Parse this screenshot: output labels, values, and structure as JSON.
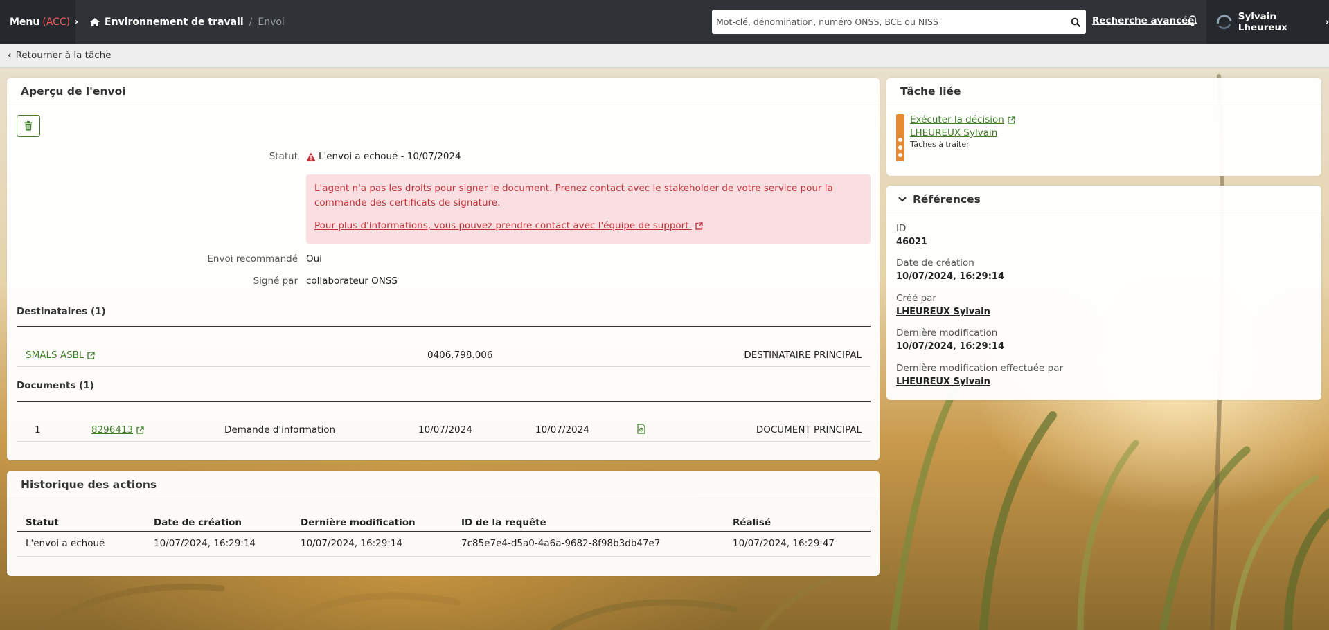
{
  "topbar": {
    "menu_label": "Menu",
    "menu_env": "(ACC)",
    "breadcrumb_1": "Environnement de travail",
    "breadcrumb_sep": "/",
    "breadcrumb_2": "Envoi",
    "search_placeholder": "Mot-clé, dénomination, numéro ONSS, BCE ou NISS",
    "advanced_search": "Recherche avancée",
    "user_name": "Sylvain Lheureux"
  },
  "subbar": {
    "back_label": "Retourner à la tâche"
  },
  "apercu": {
    "title": "Aperçu de l'envoi",
    "statut_label": "Statut",
    "statut_value": "L'envoi a echoué - 10/07/2024",
    "alert_text": "L'agent n'a pas les droits pour signer le document. Prenez contact avec le stakeholder de votre service pour la commande des certificats de signature.",
    "alert_link": "Pour plus d'informations, vous pouvez prendre contact avec l'équipe de support.",
    "recommande_label": "Envoi recommandé",
    "recommande_value": "Oui",
    "signe_label": "Signé par",
    "signe_value": "collaborateur ONSS",
    "destinataires_title": "Destinataires (1)",
    "destinataires": [
      {
        "name": "SMALS ASBL",
        "number": "0406.798.006",
        "role": "DESTINATAIRE PRINCIPAL"
      }
    ],
    "documents_title": "Documents (1)",
    "documents": [
      {
        "index": "1",
        "id": "8296413",
        "type": "Demande d'information",
        "date1": "10/07/2024",
        "date2": "10/07/2024",
        "role": "DOCUMENT PRINCIPAL"
      }
    ]
  },
  "historique": {
    "title": "Historique des actions",
    "columns": [
      "Statut",
      "Date de création",
      "Dernière modification",
      "ID de la requête",
      "Réalisé"
    ],
    "rows": [
      [
        "L'envoi a echoué",
        "10/07/2024, 16:29:14",
        "10/07/2024, 16:29:14",
        "7c85e7e4-d5a0-4a6a-9682-8f98b3db47e7",
        "10/07/2024, 16:29:47"
      ]
    ]
  },
  "tache": {
    "title": "Tâche liée",
    "link": "Exécuter la décision",
    "person": "LHEUREUX Sylvain",
    "queue": "Tâches à traiter"
  },
  "references": {
    "title": "Références",
    "id_label": "ID",
    "id_value": "46021",
    "created_label": "Date de création",
    "created_value": "10/07/2024, 16:29:14",
    "created_by_label": "Créé par",
    "created_by_value": "LHEUREUX Sylvain",
    "modified_label": "Dernière modification",
    "modified_value": "10/07/2024, 16:29:14",
    "modified_by_label": "Dernière modification effectuée par",
    "modified_by_value": "LHEUREUX Sylvain"
  },
  "colors": {
    "topbar": "#2f3338",
    "accent_green": "#3f7d2a",
    "error_red": "#c0313a",
    "error_bg": "#f9dfe1",
    "task_orange": "#e38a35"
  },
  "icons": [
    "home-icon",
    "search-icon",
    "bell-icon",
    "trash-icon",
    "warning-icon",
    "external-link-icon",
    "document-icon",
    "chevron-down-icon",
    "chevron-left-icon",
    "chevron-right-icon"
  ]
}
